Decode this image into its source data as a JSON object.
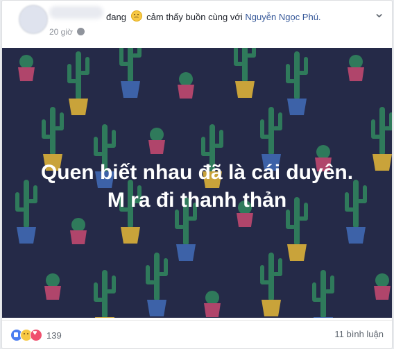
{
  "post": {
    "status_prefix": "đang",
    "feeling": "cảm thấy buồn",
    "with_text": "cùng với",
    "tagged_name": "Nguyễn Ngọc Phú.",
    "time": "20 giờ",
    "headline_line1": "Quen biết nhau đã là cái duyên.",
    "headline_line2": "M ra đi thanh thản",
    "reaction_count": "139",
    "comments": "11 bình luận"
  },
  "colors": {
    "background": "#252a48",
    "cactus": "#2f7a5b",
    "pot_pink": "#b0456b",
    "pot_yellow": "#c9a33a",
    "pot_blue": "#3d62a8",
    "link": "#365899"
  },
  "icons": [
    "globe-icon",
    "menu-icon",
    "like-reaction-icon",
    "sad-reaction-icon",
    "love-reaction-icon",
    "sad-emoji-icon"
  ]
}
